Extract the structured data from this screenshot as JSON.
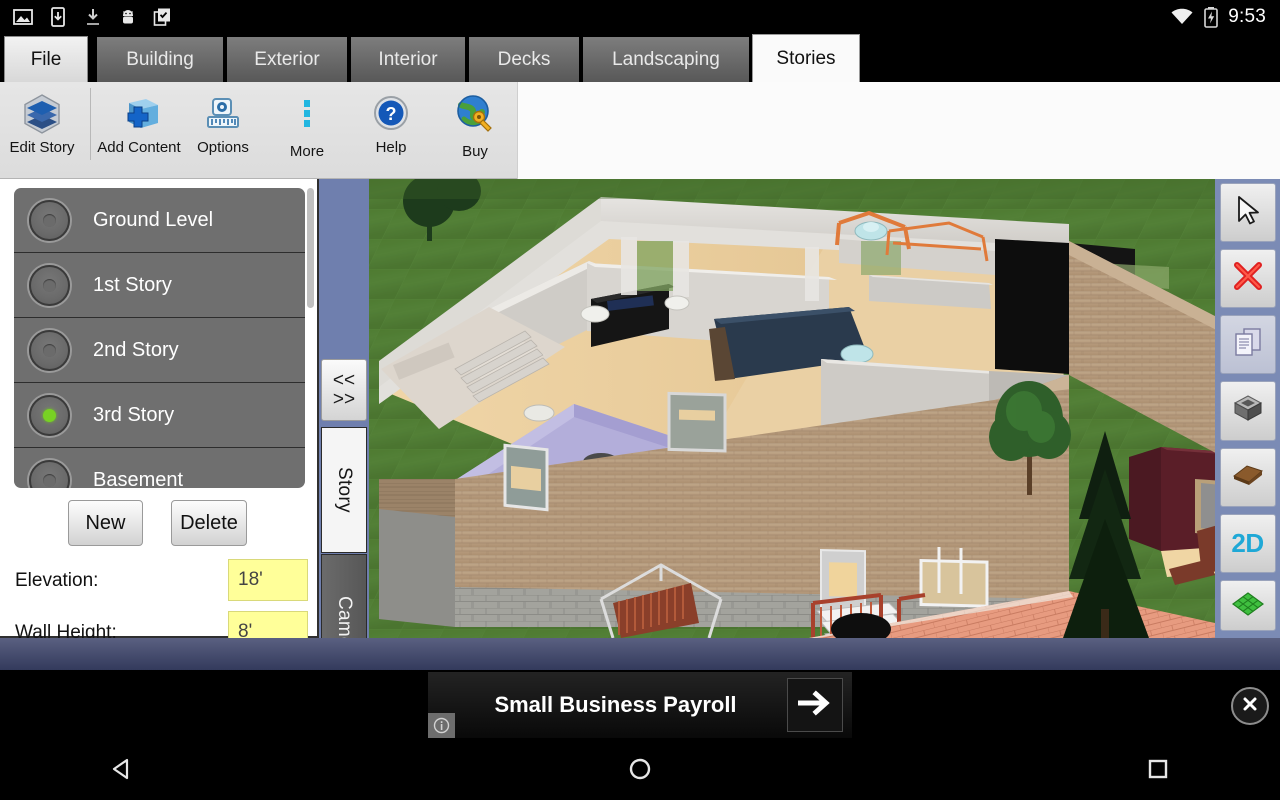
{
  "statusbar": {
    "clock": "9:53",
    "icons": [
      "photo-icon",
      "download-to-device-icon",
      "download-icon",
      "android-icon",
      "clipboard-check-icon"
    ],
    "right_icons": [
      "wifi-icon",
      "battery-charging-icon"
    ]
  },
  "tabs": [
    {
      "label": "File",
      "state": "file"
    },
    {
      "label": "Building",
      "state": "inactive"
    },
    {
      "label": "Exterior",
      "state": "inactive"
    },
    {
      "label": "Interior",
      "state": "inactive"
    },
    {
      "label": "Decks",
      "state": "inactive"
    },
    {
      "label": "Landscaping",
      "state": "inactive"
    },
    {
      "label": "Stories",
      "state": "active"
    }
  ],
  "ribbon": [
    {
      "label": "Edit Story",
      "icon": "layers-icon"
    },
    {
      "label": "Add Content",
      "icon": "add-box-icon"
    },
    {
      "label": "Options",
      "icon": "tape-measure-icon"
    },
    {
      "label": "More",
      "icon": "more-vertical-icon"
    },
    {
      "label": "Help",
      "icon": "help-circle-icon"
    },
    {
      "label": "Buy",
      "icon": "globe-key-icon"
    }
  ],
  "panel": {
    "stories": [
      {
        "label": "Ground Level",
        "selected": false
      },
      {
        "label": "1st Story",
        "selected": false
      },
      {
        "label": "2nd Story",
        "selected": false
      },
      {
        "label": "3rd Story",
        "selected": true
      },
      {
        "label": "Basement",
        "selected": false
      }
    ],
    "new_label": "New",
    "delete_label": "Delete",
    "elevation_label": "Elevation:",
    "elevation_value": "18'",
    "wall_height_label": "Wall Height:",
    "wall_height_value": "8'",
    "collapse_label_top": "<<",
    "collapse_label_bottom": ">>"
  },
  "vtabs": [
    {
      "label": "Story",
      "active": true
    },
    {
      "label": "Camera",
      "active": false
    }
  ],
  "right_toolbar": [
    {
      "name": "select-tool",
      "icon": "cursor-arrow-icon"
    },
    {
      "name": "delete-tool",
      "icon": "red-x-icon"
    },
    {
      "name": "duplicate-tool",
      "icon": "copy-pages-icon"
    },
    {
      "name": "solid-tool",
      "icon": "gray-box-icon"
    },
    {
      "name": "material-tool",
      "icon": "brown-slab-icon"
    },
    {
      "name": "view-2d-tool",
      "icon": "2d-text-icon",
      "text": "2D"
    },
    {
      "name": "terrain-tool",
      "icon": "green-grid-icon"
    }
  ],
  "ad": {
    "title": "Small Business Payroll",
    "info_icon": "info-icon",
    "arrow_icon": "arrow-right-icon",
    "close_icon": "close-circle-icon"
  },
  "navbar": [
    {
      "name": "back-button",
      "icon": "triangle-back-icon"
    },
    {
      "name": "home-button",
      "icon": "circle-home-icon"
    },
    {
      "name": "recents-button",
      "icon": "square-recents-icon"
    }
  ],
  "viewport": {
    "scene": "3d-house-exterior-cutaway",
    "colors": {
      "grass": "#4f7a32",
      "brick_wall": "#b79d7e",
      "foundation": "#9a9a96",
      "patio": "#e8967e",
      "interior_wall": "#d9d6d2",
      "purple_room": "#b0abd8",
      "dark_red_room": "#5c1f29",
      "wood_floor": "#e8cfa0"
    }
  }
}
